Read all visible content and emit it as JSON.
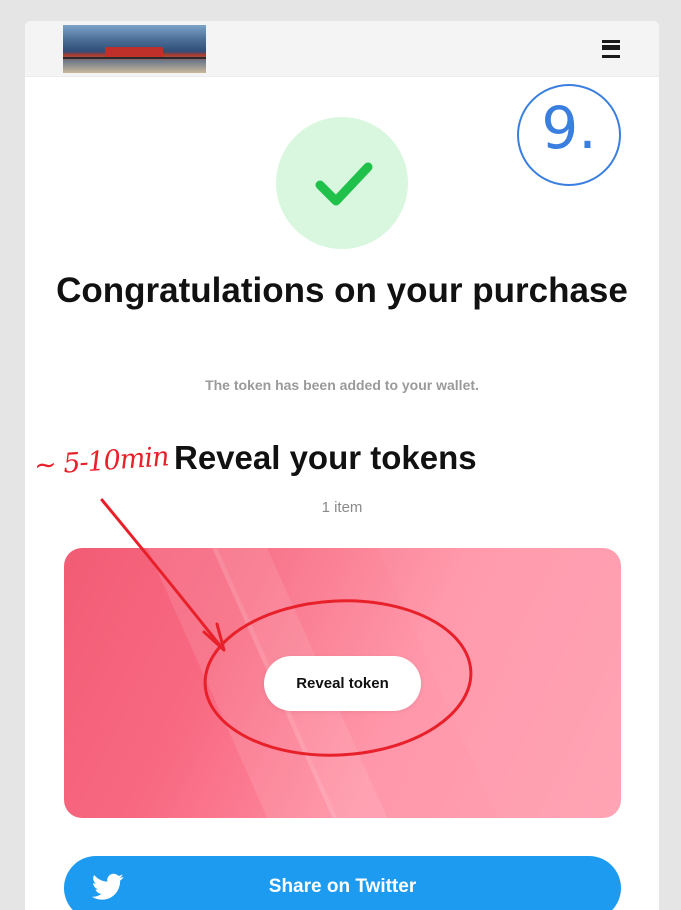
{
  "header": {
    "logo_name": "banner-logo-image",
    "menu_icon": "hamburger-menu-icon"
  },
  "success": {
    "icon": "checkmark-icon",
    "title": "Congratulations on your purchase",
    "subtitle": "The token has been added to your wallet."
  },
  "reveal": {
    "heading": "Reveal your tokens",
    "count": "1 item",
    "button_label": "Reveal token"
  },
  "share": {
    "icon": "twitter-bird-icon",
    "label": "Share on Twitter"
  },
  "annotations": {
    "time_note": "~ 5-10min",
    "step_number": "9."
  },
  "colors": {
    "success_circle": "#d8f7de",
    "check": "#1fc14a",
    "panel_pink": "#f86a82",
    "twitter_blue": "#1d9bf0",
    "annotation_red": "#e8202a",
    "annotation_blue": "#3a7fe0"
  }
}
